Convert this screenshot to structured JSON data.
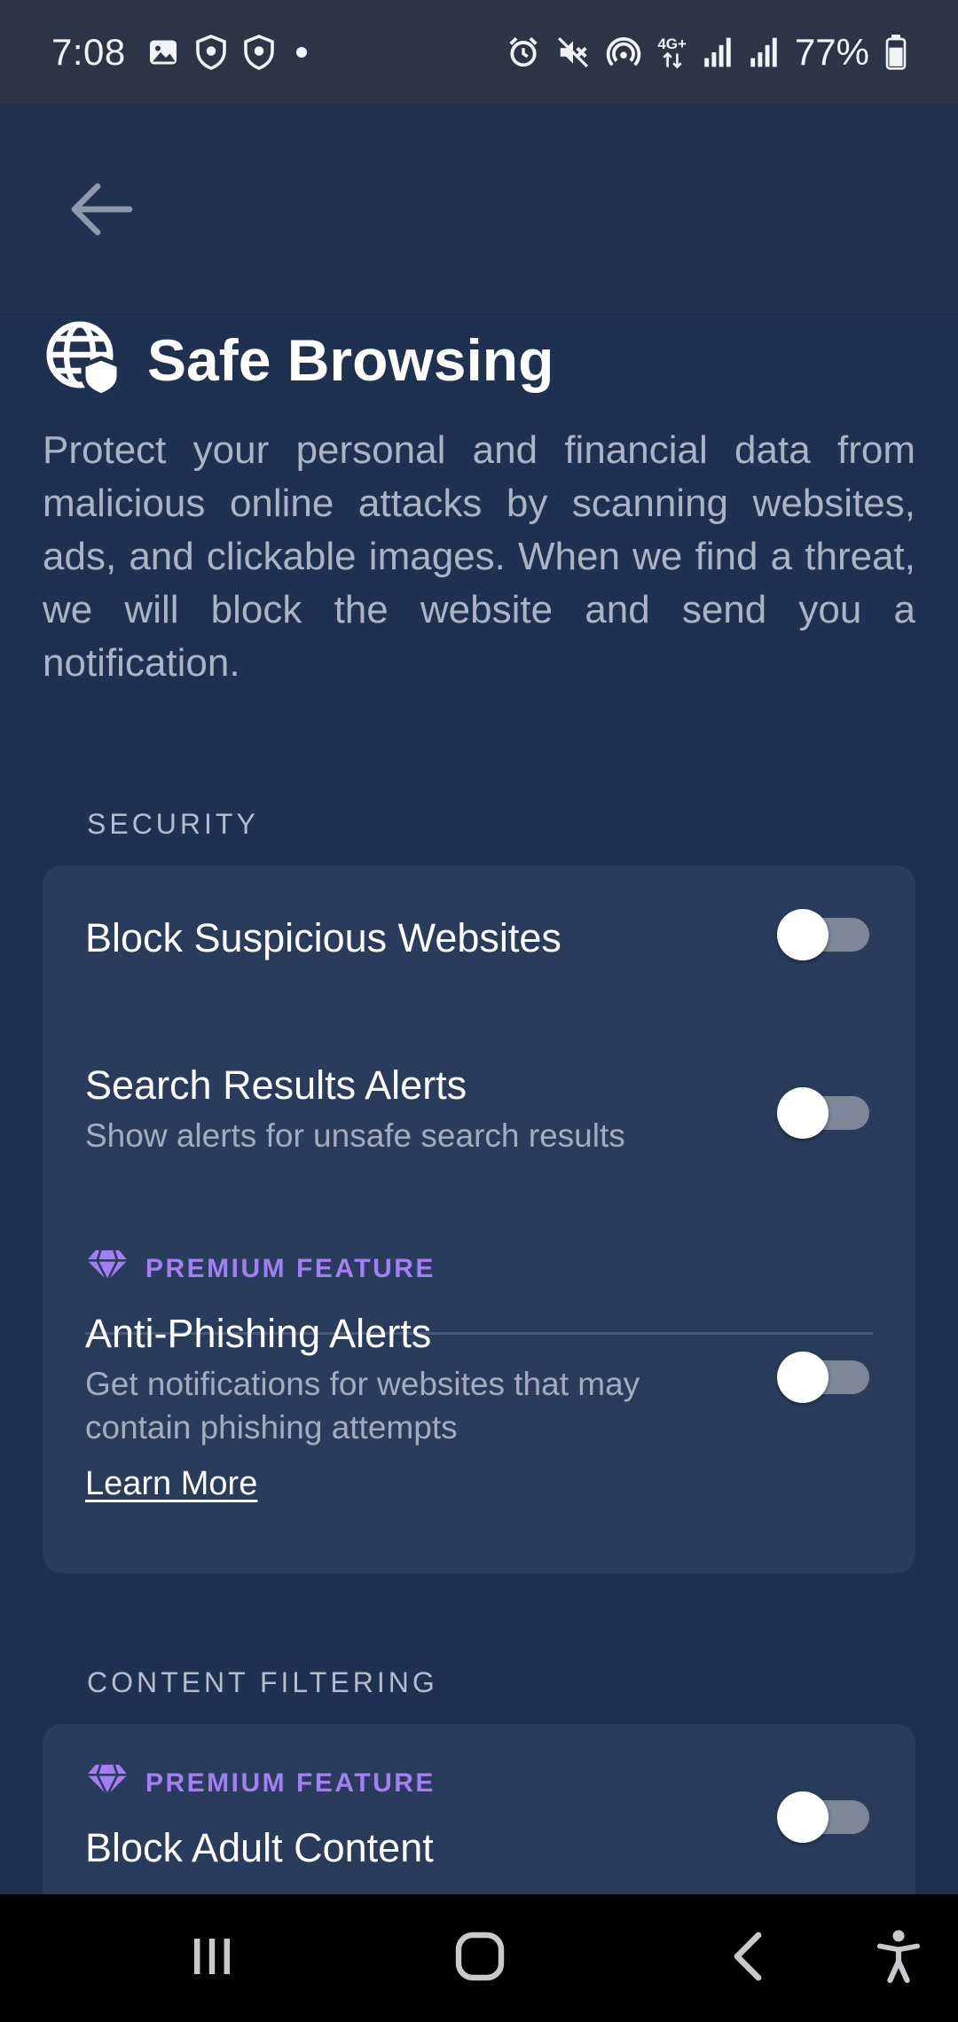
{
  "status_bar": {
    "time": "7:08",
    "battery_percent": "77%",
    "network_label": "4G+",
    "battery_level": 0.77,
    "icons": [
      "image-icon",
      "shield-icon",
      "shield-icon",
      "alarm-icon",
      "mute-icon",
      "hotspot-icon",
      "data-arrows-icon",
      "signal-icon",
      "signal-icon",
      "battery-icon"
    ]
  },
  "header": {
    "back_icon": "arrow-left-icon",
    "title": "Safe Browsing",
    "title_icon": "globe-shield-icon"
  },
  "description": "Protect your personal and financial data from malicious online attacks by scanning websites, ads, and clickable images. When we find a threat, we will block the website and send you a notification.",
  "sections": {
    "security": {
      "label": "SECURITY",
      "items": [
        {
          "title": "Block Suspicious Websites",
          "subtitle": "",
          "enabled": false
        },
        {
          "title": "Search Results Alerts",
          "subtitle": "Show alerts for unsafe search results",
          "enabled": false
        },
        {
          "premium_label": "PREMIUM FEATURE",
          "title": "Anti-Phishing Alerts",
          "subtitle": "Get notifications for websites that may contain phishing attempts",
          "link": "Learn More",
          "enabled": false
        }
      ]
    },
    "content_filtering": {
      "label": "CONTENT FILTERING",
      "items": [
        {
          "premium_label": "PREMIUM FEATURE",
          "title": "Block Adult Content",
          "enabled": false
        }
      ]
    }
  },
  "colors": {
    "background": "#1f3150",
    "card": "#293c5b",
    "premium": "#a47ef5",
    "toggle_off_track": "#7d8797"
  },
  "nav_bar": {
    "icons": [
      "recents-icon",
      "home-icon",
      "back-icon",
      "accessibility-icon"
    ]
  }
}
